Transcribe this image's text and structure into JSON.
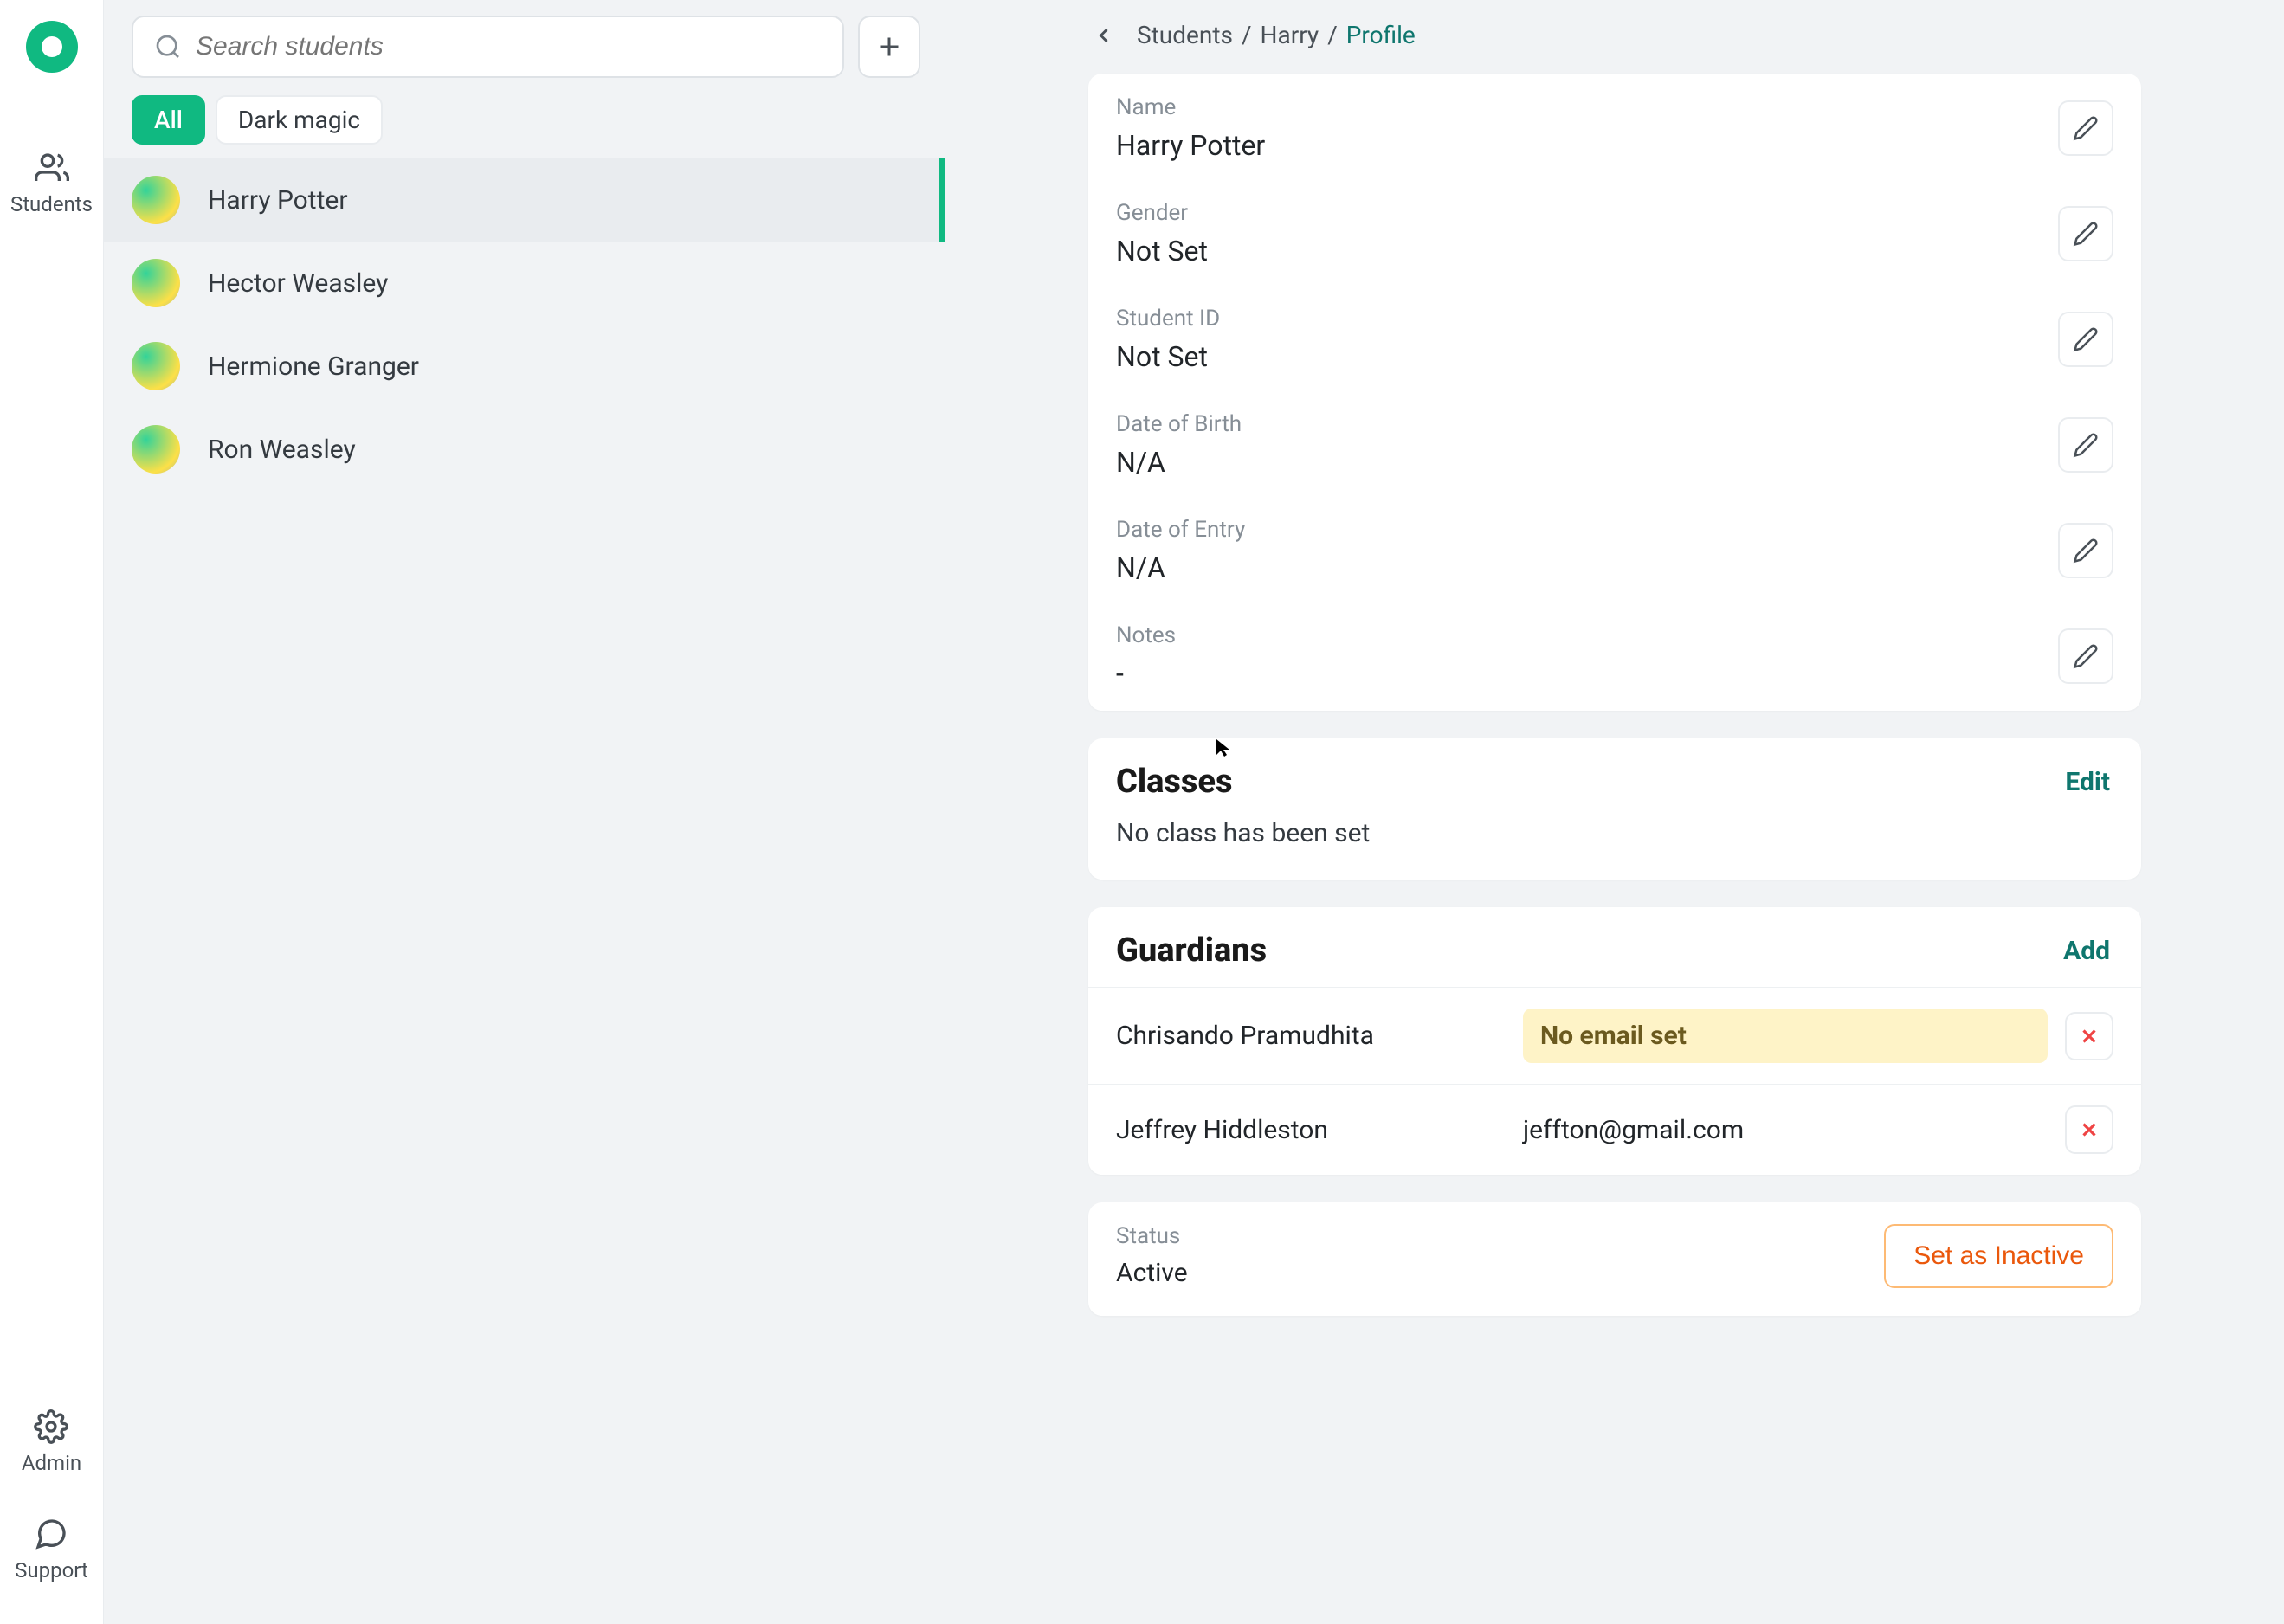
{
  "rail": {
    "students_label": "Students",
    "admin_label": "Admin",
    "support_label": "Support"
  },
  "search": {
    "placeholder": "Search students"
  },
  "filters": [
    {
      "label": "All",
      "active": true
    },
    {
      "label": "Dark magic",
      "active": false
    }
  ],
  "students": [
    {
      "name": "Harry Potter",
      "selected": true
    },
    {
      "name": "Hector Weasley",
      "selected": false
    },
    {
      "name": "Hermione Granger",
      "selected": false
    },
    {
      "name": "Ron Weasley",
      "selected": false
    }
  ],
  "breadcrumb": {
    "root": "Students",
    "mid": "Harry",
    "leaf": "Profile"
  },
  "profile": {
    "fields": [
      {
        "label": "Name",
        "value": "Harry Potter"
      },
      {
        "label": "Gender",
        "value": "Not Set"
      },
      {
        "label": "Student ID",
        "value": "Not Set"
      },
      {
        "label": "Date of Birth",
        "value": "N/A"
      },
      {
        "label": "Date of Entry",
        "value": "N/A"
      },
      {
        "label": "Notes",
        "value": "-"
      }
    ]
  },
  "classes": {
    "title": "Classes",
    "action": "Edit",
    "empty_text": "No class has been set"
  },
  "guardians": {
    "title": "Guardians",
    "action": "Add",
    "no_email_label": "No email set",
    "rows": [
      {
        "name": "Chrisando Pramudhita",
        "email": null
      },
      {
        "name": "Jeffrey Hiddleston",
        "email": "jeffton@gmail.com"
      }
    ]
  },
  "status": {
    "label": "Status",
    "value": "Active",
    "button": "Set as Inactive"
  }
}
